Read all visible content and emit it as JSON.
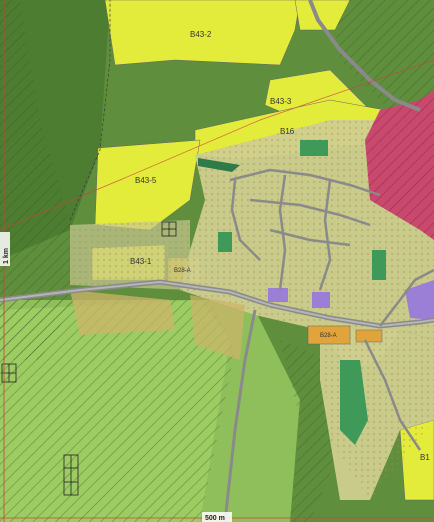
{
  "colors": {
    "forest": "#5f8f3c",
    "forest_dark": "#4d7d30",
    "agri": "#9ec46a",
    "residential_yellow": "#e6ee3a",
    "settlement": "#c9c98a",
    "commercial": "#c24a6a",
    "public": "#9b7fd6",
    "green_space": "#3f9a5a",
    "road": "#8a8a8a",
    "scale_red": "#d04040"
  },
  "zones": {
    "b43_2": "B43-2",
    "b43_3": "B43-3",
    "b16": "B16",
    "b43_5": "B43-5",
    "b43_1": "B43-1",
    "b28_a": "B28-A",
    "b28_a2": "B28-A",
    "b1": "B1"
  },
  "scale": {
    "vertical": "1 km",
    "horizontal": "500 m"
  }
}
